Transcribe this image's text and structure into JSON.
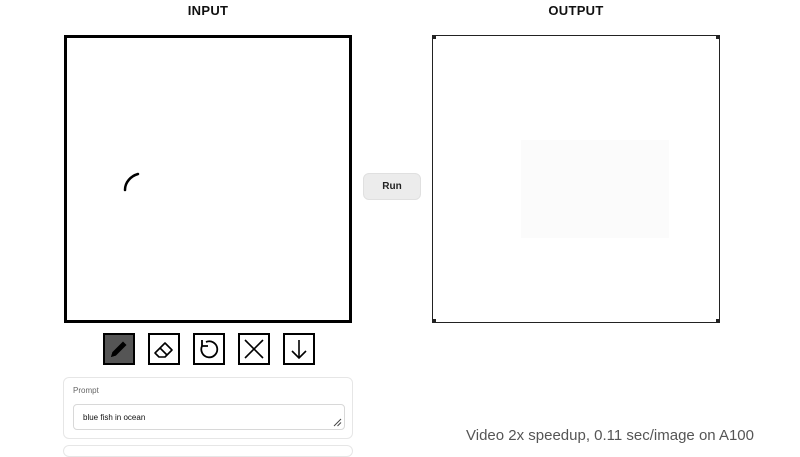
{
  "input": {
    "title": "INPUT"
  },
  "output": {
    "title": "OUTPUT"
  },
  "run_button": {
    "label": "Run"
  },
  "toolbar": {
    "tools": [
      {
        "name": "pencil",
        "icon": "pencil-icon",
        "active": true
      },
      {
        "name": "eraser",
        "icon": "eraser-icon",
        "active": false
      },
      {
        "name": "undo",
        "icon": "undo-icon",
        "active": false
      },
      {
        "name": "clear",
        "icon": "close-icon",
        "active": false
      },
      {
        "name": "download",
        "icon": "arrow-down-icon",
        "active": false
      }
    ]
  },
  "prompt": {
    "label": "Prompt",
    "value": "blue fish in ocean"
  },
  "caption": "Video 2x speedup, 0.11 sec/image on A100",
  "colors": {
    "accent_active_tool": "#555555",
    "canvas_border": "#000000",
    "button_bg": "#ececec"
  }
}
